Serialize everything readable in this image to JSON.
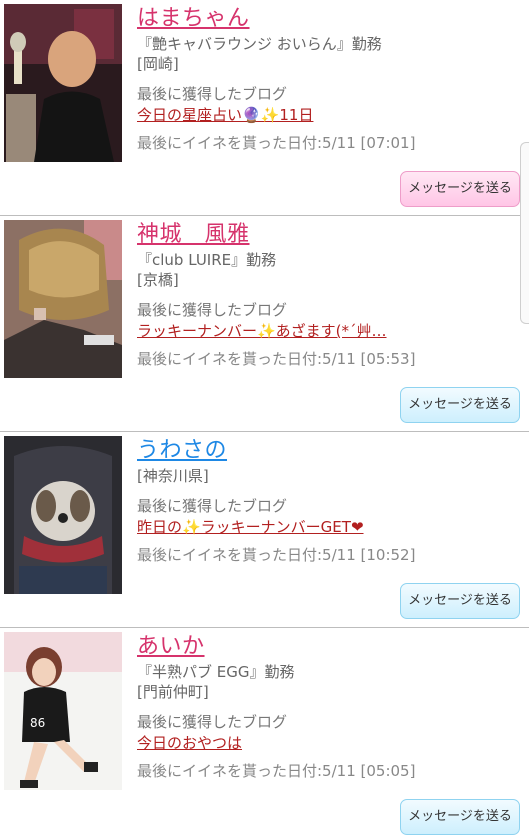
{
  "common": {
    "last_blog_label": "最後に獲得したブログ",
    "message_button": "メッセージを送る"
  },
  "users": [
    {
      "name": "はまちゃん",
      "workplace": "『艶キャバラウンジ おいらん』勤務",
      "area": "[岡崎]",
      "blog_title": "今日の星座占い🔮✨11日",
      "liked_date": "最後にイイネを貰った日付:5/11 [07:01]"
    },
    {
      "name": "神城　風雅",
      "workplace": "『club LUIRE』勤務",
      "area": "[京橋]",
      "blog_title": "ラッキーナンバー✨あざます(*´艸…",
      "liked_date": "最後にイイネを貰った日付:5/11 [05:53]"
    },
    {
      "name": "うわさの",
      "area": "[神奈川県]",
      "blog_title": "昨日の✨ラッキーナンバーGET❤",
      "liked_date": "最後にイイネを貰った日付:5/11 [10:52]"
    },
    {
      "name": "あいか",
      "workplace": "『半熟パブ EGG』勤務",
      "area": "[門前仲町]",
      "blog_title": "今日のおやつは",
      "liked_date": "最後にイイネを貰った日付:5/11 [05:05]"
    }
  ]
}
